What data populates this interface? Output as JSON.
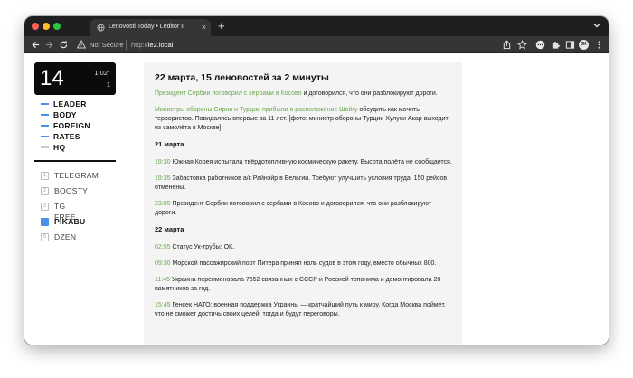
{
  "colors": {
    "accent_green": "#6aa84f",
    "accent_blue": "#4a8fe8",
    "close_light": "#ff5f57",
    "minimize_light": "#febc2e",
    "zoom_light": "#28c840"
  },
  "browser": {
    "tab_title": "Lenovosti Today • Leditor II",
    "tab_close": "×",
    "new_tab": "+",
    "security_label": "Not Secure",
    "url_scheme": "http://",
    "url_host": "le2.local",
    "profile_initial": "JK"
  },
  "widget": {
    "day": "14",
    "temp": "1.02°",
    "number": "1"
  },
  "nav": {
    "items": [
      {
        "label": "LEADER",
        "color": "#4a8fe8"
      },
      {
        "label": "BODY",
        "color": "#4a8fe8"
      },
      {
        "label": "FOREIGN",
        "color": "#4a8fe8"
      },
      {
        "label": "RATES",
        "color": "#4a8fe8"
      },
      {
        "label": "HQ",
        "color": "#cfcfcf"
      }
    ]
  },
  "sources": {
    "items": [
      {
        "num": "1",
        "label": "TELEGRAM"
      },
      {
        "num": "2",
        "label": "BOOSTY"
      },
      {
        "num": "3",
        "label": "TG FREE"
      },
      {
        "num": "",
        "label": "PIKABU",
        "active": true
      },
      {
        "num": "5",
        "label": "DZEN"
      }
    ]
  },
  "content": {
    "title": "22 марта, 15 леновостей за 2 минуты",
    "intro": [
      {
        "link": "Президент Сербии поговорил с сербами в Косово",
        "text": " и договорился, что они разблокируют дороги."
      },
      {
        "link": "Министры обороны Сирии и Турции прибыли в расположение Шойгу",
        "text": " обсудить как мочить террористов. Повидались впервые за 11 лет. [фото: министр обороны Турции Хулуси Акар выходит из самолёта в Москве]"
      }
    ],
    "sections": [
      {
        "date": "21 марта",
        "items": [
          {
            "time": "19:30",
            "text": " Южная Корея испытала твёрдотопливную космическую ракету. Высота полёта не сообщается."
          },
          {
            "time": "19:35",
            "text": " Забастовка работников а/к Райнэйр в Бельгии. Требуют улучшить условия труда. 150 рейсов отменены."
          },
          {
            "time": "23:05",
            "text": " Президент Сербии поговорил с сербами в Косово и договорился, что они разблокируют дороги."
          }
        ]
      },
      {
        "date": "22 марта",
        "items": [
          {
            "time": "02:55",
            "text": " Статус Ук-трубы: OK."
          },
          {
            "time": "09:30",
            "text": " Морской пассажирский порт Питера принял ноль судов в этом году, вместо обычных 800."
          },
          {
            "time": "11:45",
            "text": " Украина переименовала 7652 связанных с СССР и Россией топонима и демонтировала 28 памятников за год."
          },
          {
            "time": "15:45",
            "text": " Генсек НАТО: военная поддержка Украины — кратчайший путь к миру. Когда Москва поймёт, что не сможет достичь своих целей, тогда и будут переговоры."
          }
        ]
      }
    ]
  }
}
